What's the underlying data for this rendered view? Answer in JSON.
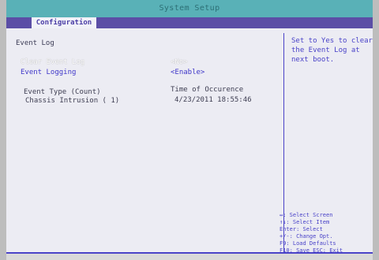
{
  "title": "System Setup",
  "tab": "Configuration",
  "section_title": "Event Log",
  "rows": [
    {
      "label": "Clear Event Log",
      "value": "<No>"
    },
    {
      "label": "Event Logging",
      "value": "<Enable>"
    }
  ],
  "event_table": {
    "col1": "Event Type (Count)",
    "col2": "Time of Occurence",
    "entries": [
      {
        "type": "Chassis Intrusion ( 1)",
        "time": "4/23/2011 18:55:46"
      }
    ]
  },
  "help": "Set to Yes to clear the Event Log at next boot.",
  "keys": [
    "↔: Select Screen",
    "↑↓: Select Item",
    "Enter: Select",
    "+/-: Change Opt.",
    "F9: Load Defaults",
    "F10: Save  ESC: Exit"
  ],
  "colors": {
    "title_bar": "#59b1b7",
    "tab_strip": "#5b4ea6",
    "text_blue": "#3f37c9",
    "background": "#ececf3"
  }
}
